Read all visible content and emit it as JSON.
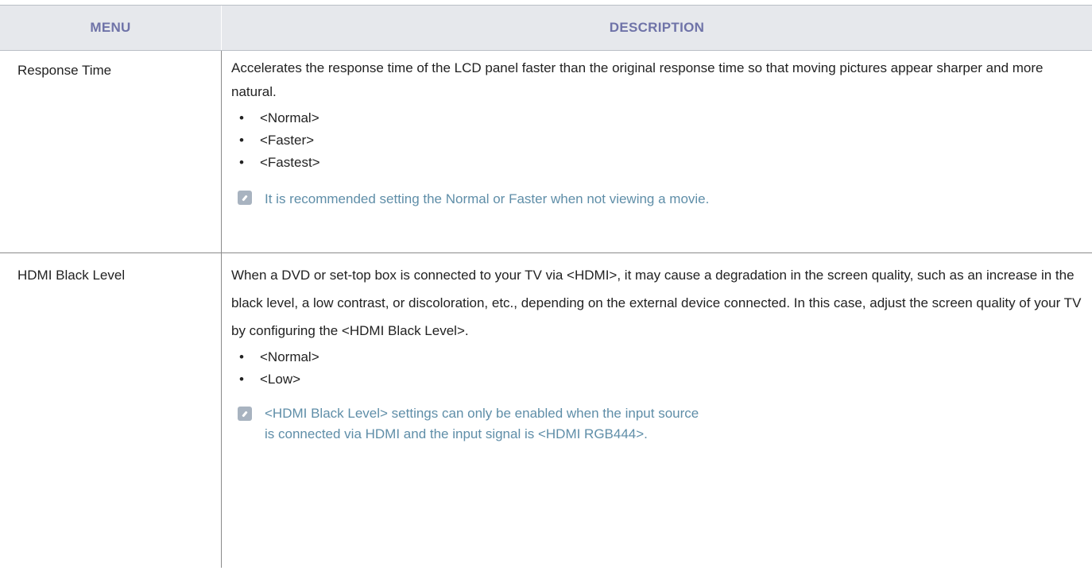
{
  "header": {
    "menu": "MENU",
    "description": "DESCRIPTION"
  },
  "rows": [
    {
      "menu": "Response Time",
      "desc": "Accelerates the response time of the LCD panel faster than the original response time so that moving pictures appear sharper and more natural.",
      "options": [
        "<Normal>",
        "<Faster>",
        "<Fastest>"
      ],
      "note": "It is recommended setting the Normal or Faster when not viewing a movie."
    },
    {
      "menu": "HDMI Black Level",
      "desc": "When a DVD or set-top box is connected to your TV via <HDMI>, it may cause a degradation in the screen quality, such as an increase in the black level, a low contrast, or discoloration, etc., depending on the external device connected. In this case, adjust the screen quality of your TV by configuring the <HDMI Black Level>.",
      "options": [
        "<Normal>",
        "<Low>"
      ],
      "note": "<HDMI Black Level> settings can only be enabled when the input source is connected via HDMI and the input signal is <HDMI RGB444>."
    }
  ],
  "bullet": "•",
  "note_icon": "pencil-note-icon",
  "colors": {
    "header_bg": "#e6e8ec",
    "header_text": "#6f73a8",
    "note_text": "#5f8ea8"
  }
}
